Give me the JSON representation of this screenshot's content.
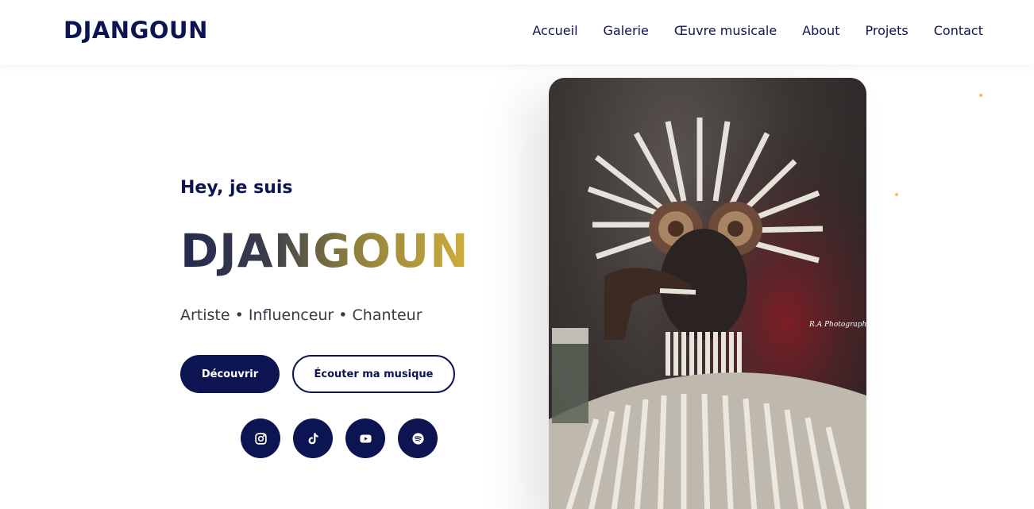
{
  "header": {
    "brand": "DJANGOUN",
    "nav": [
      "Accueil",
      "Galerie",
      "Œuvre musicale",
      "About",
      "Projets",
      "Contact"
    ]
  },
  "hero": {
    "greeting": "Hey, je suis",
    "name": "DJANGOUN",
    "roles": "Artiste • Influenceur • Chanteur",
    "primary_button": "Découvrir",
    "secondary_button": "Écouter ma musique",
    "socials": [
      "instagram-icon",
      "tiktok-icon",
      "youtube-icon",
      "spotify-icon"
    ]
  },
  "photo": {
    "watermark": "R.A Photography"
  },
  "colors": {
    "navy": "#0d1452",
    "gold": "#cfae3a",
    "text_gray": "#3a3a46"
  }
}
